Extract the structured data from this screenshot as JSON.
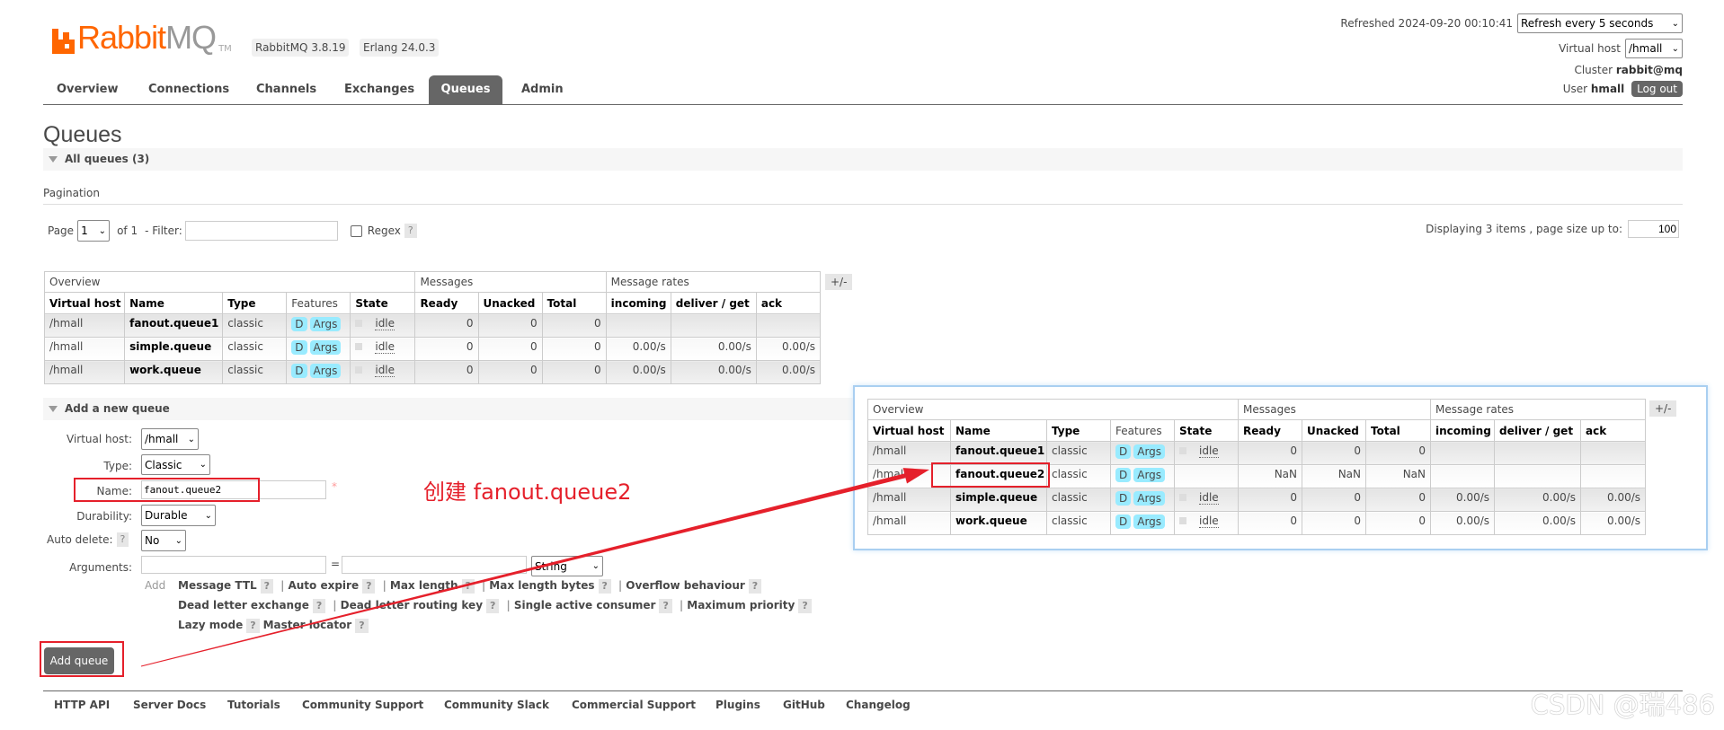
{
  "logo": {
    "text_primary": "Rabbit",
    "text_secondary": "MQ",
    "tm": "TM"
  },
  "versions": {
    "rabbitmq": "RabbitMQ 3.8.19",
    "erlang": "Erlang 24.0.3"
  },
  "nav": {
    "tabs": [
      {
        "label": "Overview"
      },
      {
        "label": "Connections"
      },
      {
        "label": "Channels"
      },
      {
        "label": "Exchanges"
      },
      {
        "label": "Queues",
        "active": true
      },
      {
        "label": "Admin"
      }
    ]
  },
  "header": {
    "refreshed_label": "Refreshed 2024-09-20 00:10:41",
    "refresh_select": "Refresh every 5 seconds",
    "vhost_label": "Virtual host",
    "vhost_select": "/hmall",
    "cluster_label": "Cluster",
    "cluster_value": "rabbit@mq",
    "user_label": "User",
    "user_value": "hmall",
    "logout_label": "Log out"
  },
  "page": {
    "title": "Queues",
    "all_queues_label": "All queues (3)"
  },
  "pagination": {
    "heading": "Pagination",
    "page_label": "Page",
    "page_value": "1",
    "of_label": "of 1",
    "filter_label": "- Filter:",
    "filter_value": "",
    "regex_label": "Regex",
    "help": "?",
    "displaying": "Displaying 3 items , page size up to:",
    "page_size": "100"
  },
  "queue_table": {
    "groups": [
      {
        "label": "Overview",
        "span": 5
      },
      {
        "label": "Messages",
        "span": 3
      },
      {
        "label": "Message rates",
        "span": 3
      }
    ],
    "columns": [
      {
        "label": "Virtual host",
        "bold": true
      },
      {
        "label": "Name",
        "bold": true
      },
      {
        "label": "Type",
        "bold": true
      },
      {
        "label": "Features",
        "bold": false
      },
      {
        "label": "State",
        "bold": true
      },
      {
        "label": "Ready",
        "bold": true
      },
      {
        "label": "Unacked",
        "bold": true
      },
      {
        "label": "Total",
        "bold": true
      },
      {
        "label": "incoming",
        "bold": true
      },
      {
        "label": "deliver / get",
        "bold": true
      },
      {
        "label": "ack",
        "bold": true
      }
    ],
    "toggle_label": "+/-",
    "rows": [
      {
        "vhost": "/hmall",
        "name": "fanout.queue1",
        "type": "classic",
        "features": [
          "D",
          "Args"
        ],
        "state": "idle",
        "ready": "0",
        "unacked": "0",
        "total": "0",
        "incoming": "",
        "deliver_get": "",
        "ack": ""
      },
      {
        "vhost": "/hmall",
        "name": "simple.queue",
        "type": "classic",
        "features": [
          "D",
          "Args"
        ],
        "state": "idle",
        "ready": "0",
        "unacked": "0",
        "total": "0",
        "incoming": "0.00/s",
        "deliver_get": "0.00/s",
        "ack": "0.00/s"
      },
      {
        "vhost": "/hmall",
        "name": "work.queue",
        "type": "classic",
        "features": [
          "D",
          "Args"
        ],
        "state": "idle",
        "ready": "0",
        "unacked": "0",
        "total": "0",
        "incoming": "0.00/s",
        "deliver_get": "0.00/s",
        "ack": "0.00/s"
      }
    ]
  },
  "add_queue": {
    "section_label": "Add a new queue",
    "vhost_label": "Virtual host:",
    "vhost_value": "/hmall",
    "type_label": "Type:",
    "type_value": "Classic",
    "name_label": "Name:",
    "name_value": "fanout.queue2",
    "required_mark": "*",
    "durability_label": "Durability:",
    "durability_value": "Durable",
    "auto_delete_label": "Auto delete:",
    "auto_delete_value": "No",
    "arguments_label": "Arguments:",
    "arg_key": "",
    "arg_eq": "=",
    "arg_value": "",
    "arg_type": "String",
    "add_label": "Add",
    "arg_links": [
      [
        "Message TTL",
        "Auto expire",
        "Max length",
        "Max length bytes",
        "Overflow behaviour"
      ],
      [
        "Dead letter exchange",
        "Dead letter routing key",
        "Single active consumer",
        "Maximum priority"
      ],
      [
        "Lazy mode",
        "Master locator"
      ]
    ],
    "help": "?",
    "submit_label": "Add queue"
  },
  "annotation": {
    "text": "创建 fanout.queue2",
    "color": "#e5202b"
  },
  "inset_table": {
    "groups": [
      {
        "label": "Overview",
        "span": 5
      },
      {
        "label": "Messages",
        "span": 3
      },
      {
        "label": "Message rates",
        "span": 3
      }
    ],
    "toggle_label": "+/-",
    "rows": [
      {
        "vhost": "/hmall",
        "name": "fanout.queue1",
        "type": "classic",
        "features": [
          "D",
          "Args"
        ],
        "state": "idle",
        "ready": "0",
        "unacked": "0",
        "total": "0",
        "incoming": "",
        "deliver_get": "",
        "ack": ""
      },
      {
        "vhost": "/hmall",
        "name": "fanout.queue2",
        "type": "classic",
        "features": [
          "D",
          "Args"
        ],
        "state": "",
        "ready": "NaN",
        "unacked": "NaN",
        "total": "NaN",
        "incoming": "",
        "deliver_get": "",
        "ack": ""
      },
      {
        "vhost": "/hmall",
        "name": "simple.queue",
        "type": "classic",
        "features": [
          "D",
          "Args"
        ],
        "state": "idle",
        "ready": "0",
        "unacked": "0",
        "total": "0",
        "incoming": "0.00/s",
        "deliver_get": "0.00/s",
        "ack": "0.00/s"
      },
      {
        "vhost": "/hmall",
        "name": "work.queue",
        "type": "classic",
        "features": [
          "D",
          "Args"
        ],
        "state": "idle",
        "ready": "0",
        "unacked": "0",
        "total": "0",
        "incoming": "0.00/s",
        "deliver_get": "0.00/s",
        "ack": "0.00/s"
      }
    ]
  },
  "footer": {
    "links": [
      "HTTP API",
      "Server Docs",
      "Tutorials",
      "Community Support",
      "Community Slack",
      "Commercial Support",
      "Plugins",
      "GitHub",
      "Changelog"
    ]
  },
  "watermark": "CSDN @瑞486",
  "colors": {
    "brand": "#ff6600",
    "active_tab": "#666666",
    "feature_badge": "#99ebff",
    "annotation_red": "#e5202b"
  }
}
